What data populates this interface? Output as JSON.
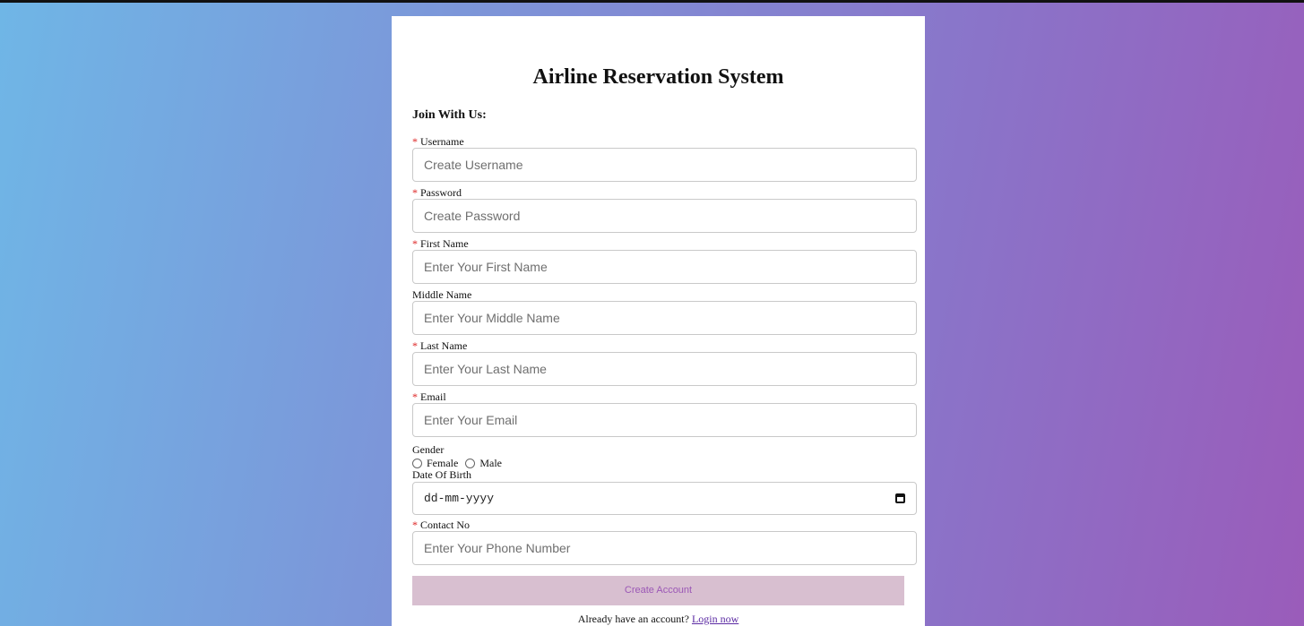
{
  "title": "Airline Reservation System",
  "subtitle": "Join With Us:",
  "required_marker": "*",
  "fields": {
    "username": {
      "label": "Username",
      "placeholder": "Create Username"
    },
    "password": {
      "label": "Password",
      "placeholder": "Create Password"
    },
    "first_name": {
      "label": "First Name",
      "placeholder": "Enter Your First Name"
    },
    "middle_name": {
      "label": "Middle Name",
      "placeholder": "Enter Your Middle Name"
    },
    "last_name": {
      "label": "Last Name",
      "placeholder": "Enter Your Last Name"
    },
    "email": {
      "label": "Email",
      "placeholder": "Enter Your Email"
    },
    "contact": {
      "label": "Contact No",
      "placeholder": "Enter Your Phone Number"
    }
  },
  "gender": {
    "label": "Gender",
    "options": [
      "Female",
      "Male"
    ]
  },
  "dob": {
    "label": "Date Of Birth",
    "placeholder": "dd-mm-yyyy",
    "icon": "calendar-icon"
  },
  "create_button": "Create Account",
  "footer": {
    "text": "Already have an account?",
    "link": "Login now"
  },
  "colors": {
    "required": "#dd2222",
    "button_bg": "#d8bfd0",
    "button_text": "#9b58b6",
    "link": "#5b2aa3"
  }
}
